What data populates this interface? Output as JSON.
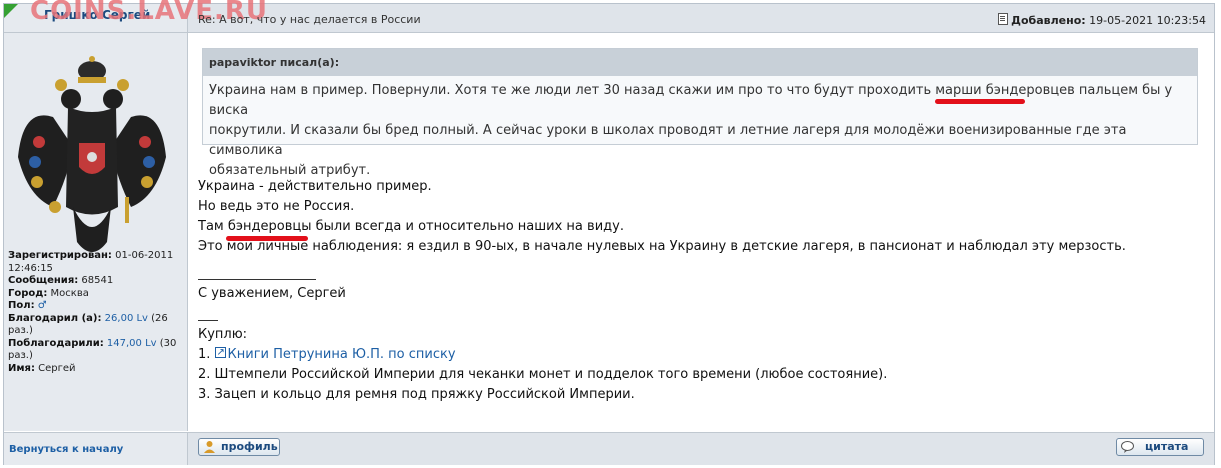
{
  "header": {
    "author": "Гришко Сергей",
    "watermark": "COINS.LAVE.RU",
    "subject": "Re: А вот, что у нас делается в России",
    "added_label": "Добавлено:",
    "added_value": "19-05-2021 10:23:54"
  },
  "user": {
    "registered_label": "Зарегистрирован:",
    "registered_value": "01-06-2011 12:46:15",
    "messages_label": "Сообщения:",
    "messages_value": "68541",
    "city_label": "Город:",
    "city_value": "Москва",
    "gender_label": "Пол:",
    "gender_symbol": "♂",
    "thanked_label": "Благодарил (а):",
    "thanked_amount": "26,00 Lv",
    "thanked_times": "(26 раз.)",
    "got_thanks_label": "Поблагодарили:",
    "got_thanks_amount": "147,00 Lv",
    "got_thanks_times": "(30 раз.)",
    "name_label": "Имя:",
    "name_value": "Сергей"
  },
  "quote": {
    "header": "papaviktor писал(а):",
    "line1_a": "Украина нам в пример. Повернули. Хотя те же люди лет 30 назад скажи им про то что будут проходить марши ",
    "line1_word": "бэндеровцев",
    "line1_b": " пальцем бы у виска",
    "line2": "покрутили. И сказали бы бред полный. А сейчас уроки в школах проводят и летние лагеря для молодёжи военизированные где эта символика",
    "line3": "обязательный атрибут."
  },
  "post": {
    "p1": "Украина - действительно пример.",
    "p2": "Но ведь это не Россия.",
    "p3_a": "Там ",
    "p3_word": "бэндеровцы",
    "p3_b": " были всегда и относительно наших на виду.",
    "p4": "Это мои личные наблюдения: я ездил в 90-ых, в начале нулевых на Украину в детские лагеря, в пансионат и наблюдал эту мерзость.",
    "sig_regards": "С уважением, Сергей",
    "buy_label": "Куплю:",
    "buy1_num": "1. ",
    "buy1_link": "Книги Петрунина Ю.П. по списку",
    "buy2": "2. Штемпели Российской Империи для чеканки монет и подделок того времени (любое состояние).",
    "buy3": "3. Зацеп и кольцо для ремня под пряжку Российской Империи."
  },
  "footer": {
    "back_to_top": "Вернуться к началу",
    "profile_btn": "профиль",
    "quote_btn": "цитата"
  },
  "colors": {
    "accent": "#1d5fa5",
    "underline": "#e3101a",
    "corner": "#36a133"
  }
}
